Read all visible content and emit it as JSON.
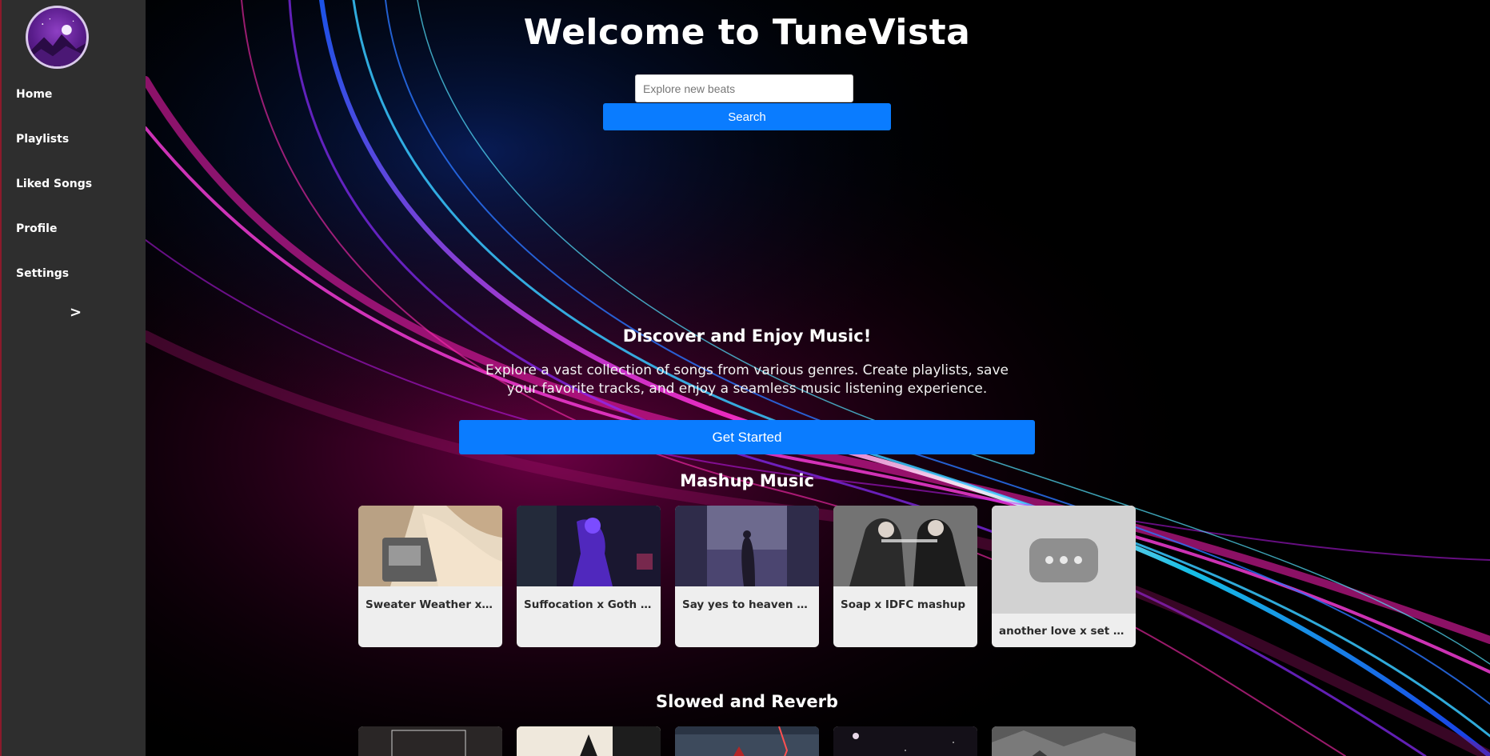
{
  "app": {
    "title": "Welcome to TuneVista"
  },
  "sidebar": {
    "items": [
      {
        "label": "Home"
      },
      {
        "label": "Playlists"
      },
      {
        "label": "Liked Songs"
      },
      {
        "label": "Profile"
      },
      {
        "label": "Settings"
      }
    ],
    "toggle_label": ">"
  },
  "search": {
    "placeholder": "Explore new beats",
    "button_label": "Search"
  },
  "hero": {
    "heading": "Discover and Enjoy Music!",
    "text": "Explore a vast collection of songs from various genres. Create playlists, save your favorite tracks, and enjoy a seamless music listening experience.",
    "cta_label": "Get Started"
  },
  "mashup": {
    "heading": "Mashup Music",
    "cards": [
      {
        "title": "Sweater Weather x Afterdark"
      },
      {
        "title": "Suffocation x Goth (Slowed)"
      },
      {
        "title": "Say yes to heaven x space song"
      },
      {
        "title": "Soap x IDFC mashup"
      },
      {
        "title": "another love x set fire to the rain"
      }
    ]
  },
  "slowed": {
    "heading": "Slowed and Reverb",
    "cards": [
      {},
      {},
      {},
      {},
      {}
    ]
  },
  "colors": {
    "accent": "#0a7cff",
    "sidebar": "#2e2e2e",
    "card": "#eeeeee"
  }
}
